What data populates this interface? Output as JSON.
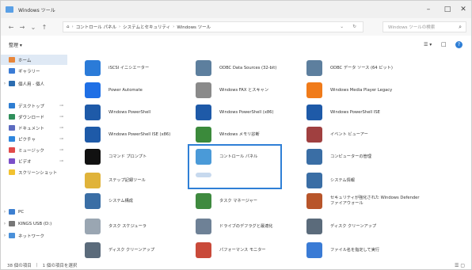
{
  "window": {
    "title": "Windows ツール",
    "controls": {
      "minimize": "–",
      "maximize": "□",
      "close": "✕"
    }
  },
  "address": {
    "back": "←",
    "forward": "→",
    "recent": "⌄",
    "up": "↑",
    "home": "⌂",
    "crumbs": [
      "コントロール パネル",
      "システムとセキュリティ",
      "Windows ツール"
    ],
    "dropdown": "⌄",
    "refresh": "↻",
    "search_placeholder": "Windows ツールの検索",
    "search_icon": "⌕"
  },
  "toolbar": {
    "view_label": "整理 ▾",
    "view_toggle": "☰ ▾",
    "layout": "□",
    "help": "?"
  },
  "sidebar": {
    "items": [
      {
        "label": "ホーム",
        "color": "#e8863a",
        "expander": "",
        "pinned": false,
        "selected": true
      },
      {
        "label": "ギャラリー",
        "color": "#3a7bd5",
        "expander": "",
        "pinned": false,
        "selected": false
      },
      {
        "label": "個人用 - 個人",
        "color": "#2b6cb0",
        "expander": "›",
        "pinned": false,
        "selected": false
      },
      {
        "label": "デスクトップ",
        "color": "#2d7dd2",
        "expander": "",
        "pinned": true,
        "selected": false
      },
      {
        "label": "ダウンロード",
        "color": "#2f8f5b",
        "expander": "",
        "pinned": true,
        "selected": false
      },
      {
        "label": "ドキュメント",
        "color": "#5c6bc0",
        "expander": "",
        "pinned": true,
        "selected": false
      },
      {
        "label": "ピクチャ",
        "color": "#2e86de",
        "expander": "",
        "pinned": true,
        "selected": false
      },
      {
        "label": "ミュージック",
        "color": "#e24a4a",
        "expander": "",
        "pinned": true,
        "selected": false
      },
      {
        "label": "ビデオ",
        "color": "#7b4fc9",
        "expander": "",
        "pinned": true,
        "selected": false
      },
      {
        "label": "スクリーンショット",
        "color": "#f2c230",
        "expander": "",
        "pinned": false,
        "selected": false
      },
      {
        "label": "PC",
        "color": "#3c7fd0",
        "expander": "›",
        "pinned": false,
        "selected": false
      },
      {
        "label": "KINGS USB (D:)",
        "color": "#777777",
        "expander": "›",
        "pinned": false,
        "selected": false
      },
      {
        "label": "ネットワーク",
        "color": "#4a90d9",
        "expander": "›",
        "pinned": false,
        "selected": false
      }
    ]
  },
  "tiles": {
    "col1": [
      {
        "label": "iSCSI イニシエーター",
        "icon": "globe-icon",
        "color": "#2b7bd8"
      },
      {
        "label": "Power Automate",
        "icon": "power-automate-icon",
        "color": "#1f6fe5"
      },
      {
        "label": "Windows PowerShell",
        "icon": "powershell-icon",
        "color": "#1e5aa8"
      },
      {
        "label": "Windows PowerShell ISE (x86)",
        "icon": "powershell-ise-icon",
        "color": "#1e5aa8"
      },
      {
        "label": "コマンド プロンプト",
        "icon": "command-prompt-icon",
        "color": "#111111"
      },
      {
        "label": "ステップ記録ツール",
        "icon": "steps-recorder-icon",
        "color": "#e0b33a"
      },
      {
        "label": "システム構成",
        "icon": "system-config-icon",
        "color": "#3a6ea5"
      },
      {
        "label": "タスク スケジューラ",
        "icon": "task-scheduler-icon",
        "color": "#9aa6b2"
      },
      {
        "label": "ディスク クリーンアップ",
        "icon": "disk-cleanup-icon",
        "color": "#5b6b7b"
      }
    ],
    "col2": [
      {
        "label": "ODBC Data Sources (32-bit)",
        "icon": "odbc-icon",
        "color": "#5d7f9e"
      },
      {
        "label": "Windows FAX とスキャン",
        "icon": "fax-scan-icon",
        "color": "#8a8a8a"
      },
      {
        "label": "Windows PowerShell (x86)",
        "icon": "powershell-x86-icon",
        "color": "#1e5aa8"
      },
      {
        "label": "Windows メモリ診断",
        "icon": "memory-diagnostic-icon",
        "color": "#3b8a3b"
      },
      {
        "label": "コントロール パネル",
        "icon": "control-panel-icon",
        "color": "#4a9ad8"
      },
      {
        "label": "",
        "icon": "partial-icon",
        "color": "#c7d9ee"
      },
      {
        "label": "タスク マネージャー",
        "icon": "task-manager-icon",
        "color": "#3f8a3f"
      },
      {
        "label": "ドライブのデフラグと最適化",
        "icon": "defrag-icon",
        "color": "#6e8196"
      },
      {
        "label": "パフォーマンス モニター",
        "icon": "performance-monitor-icon",
        "color": "#c94a3a"
      }
    ],
    "col3": [
      {
        "label": "ODBC データ ソース (64 ビット)",
        "icon": "odbc64-icon",
        "color": "#5d7f9e"
      },
      {
        "label": "Windows Media Player Legacy",
        "icon": "media-player-icon",
        "color": "#f07b1a"
      },
      {
        "label": "Windows PowerShell ISE",
        "icon": "powershell-ise-x64-icon",
        "color": "#1e5aa8"
      },
      {
        "label": "イベント ビューアー",
        "icon": "event-viewer-icon",
        "color": "#a04040"
      },
      {
        "label": "コンピューターの管理",
        "icon": "computer-management-icon",
        "color": "#3a6ea5"
      },
      {
        "label": "システム情報",
        "icon": "system-info-icon",
        "color": "#3a6ea5"
      },
      {
        "label": "セキュリティが強化された Windows Defender ファイアウォール",
        "icon": "firewall-icon",
        "color": "#b8552a"
      },
      {
        "label": "ディスク クリーンアップ",
        "icon": "disk-cleanup-2-icon",
        "color": "#5b6b7b"
      },
      {
        "label": "ファイル名を指定して実行",
        "icon": "run-icon",
        "color": "#3a7bd5"
      }
    ]
  },
  "status": {
    "count": "38 個の項目",
    "selected": "1 個の項目を選択",
    "view_icons": "☰ ▢"
  }
}
